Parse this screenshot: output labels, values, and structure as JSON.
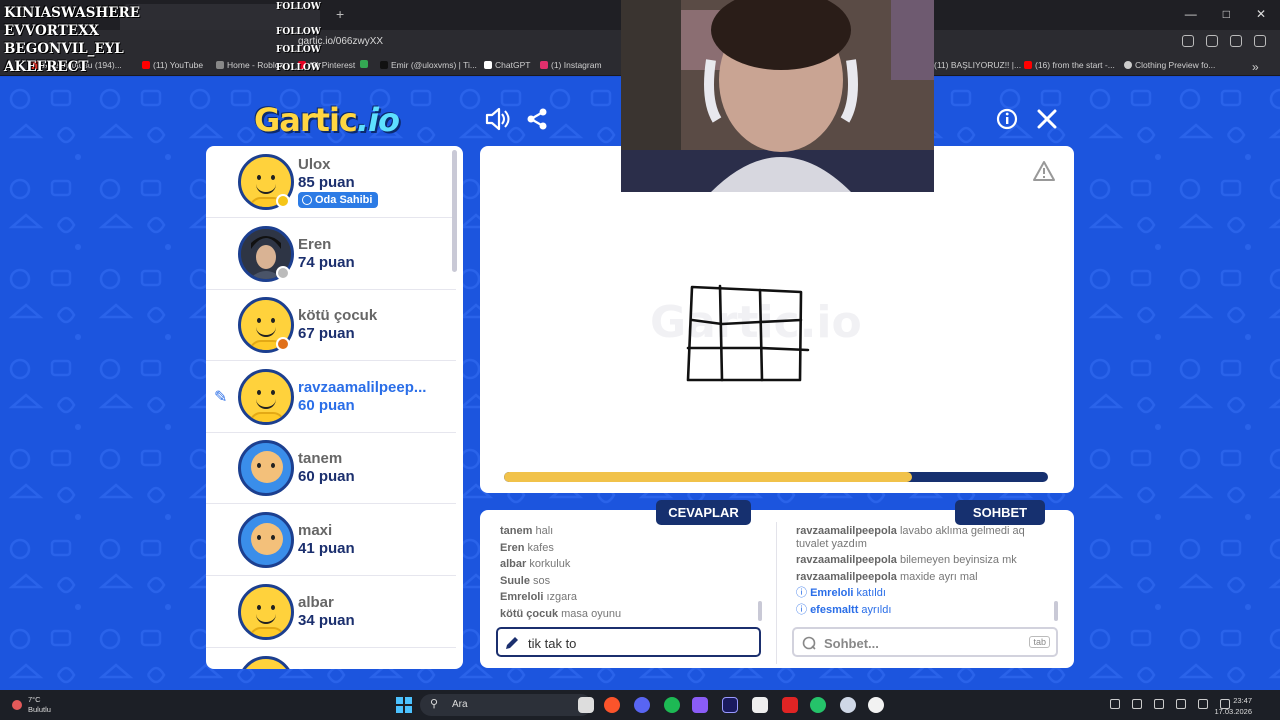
{
  "browser": {
    "url": "gartic.io/066zwyXX",
    "bookmarks": [
      {
        "label": "Gelen Kutusu (194)...",
        "color": "#d93025"
      },
      {
        "label": "(11) YouTube",
        "color": "#ff0000"
      },
      {
        "label": "Home - Roblox",
        "color": "#888888"
      },
      {
        "label": "(3) Pinterest",
        "color": "#e60023"
      },
      {
        "label": "",
        "color": "#34a853"
      },
      {
        "label": "Emir (@uloxvms) | Ti...",
        "color": "#111111"
      },
      {
        "label": "ChatGPT",
        "color": "#ffffff"
      },
      {
        "label": "(1) Instagram",
        "color": "#e1306c"
      },
      {
        "label": "(11) BAŞLIYORUZ!! |...",
        "color": "#ff0000"
      },
      {
        "label": "(16) from the start -...",
        "color": "#ff0000"
      },
      {
        "label": "Clothing Preview fo...",
        "color": "#cccccc"
      }
    ]
  },
  "stream_overlay": {
    "names": [
      "KINIASWASHERE",
      "EVVORTEXX",
      "BEGONVIL_EYL",
      "AKEFRECT"
    ],
    "follow_label": "FOLLOW"
  },
  "game": {
    "logo_main": "Gartic",
    "logo_io": ".io",
    "icons": [
      "sound-icon",
      "share-icon",
      "info-icon",
      "close-icon",
      "warning-icon"
    ],
    "timer_progress": 0.75,
    "players": [
      {
        "name": "Ulox",
        "score": "85 puan",
        "badge": "Oda Sahibi",
        "status_color": "#f5c518",
        "avatar": "default"
      },
      {
        "name": "Eren",
        "score": "74 puan",
        "status_color": "#bbbbbb",
        "avatar": "photo"
      },
      {
        "name": "kötü çocuk",
        "score": "67 puan",
        "status_color": "#e0701a",
        "avatar": "default"
      },
      {
        "name": "ravzaamalilpeep...",
        "score": "60 puan",
        "drawing": true,
        "avatar": "default"
      },
      {
        "name": "tanem",
        "score": "60 puan",
        "avatar": "blue"
      },
      {
        "name": "maxi",
        "score": "41 puan",
        "avatar": "blue"
      },
      {
        "name": "albar",
        "score": "34 puan",
        "avatar": "default"
      }
    ],
    "answers_tab": "CEVAPLAR",
    "chat_tab": "SOHBET",
    "answers": [
      {
        "who": "tanem",
        "text": "halı"
      },
      {
        "who": "Eren",
        "text": "kafes"
      },
      {
        "who": "albar",
        "text": "korkuluk"
      },
      {
        "who": "Suule",
        "text": "sos"
      },
      {
        "who": "Emreloli",
        "text": "ızgara"
      },
      {
        "who": "kötü çocuk",
        "text": "masa oyunu"
      }
    ],
    "chat": [
      {
        "who": "ravzaamalilpeepola",
        "text": "lavabo aklıma gelmedi aq tuvalet yazdım"
      },
      {
        "who": "ravzaamalilpeepola",
        "text": "bilemeyen beyinsiza mk"
      },
      {
        "who": "ravzaamalilpeepola",
        "text": "maxide ayrı mal"
      }
    ],
    "system_msgs": [
      {
        "who": "Emreloli",
        "text": "katıldı"
      },
      {
        "who": "efesmaltt",
        "text": "ayrıldı"
      }
    ],
    "answer_input_value": "tik tak to",
    "chat_placeholder": "Sohbet...",
    "tab_hint": "tab"
  },
  "taskbar": {
    "weather_temp": "7°C",
    "weather_desc": "Bulutlu",
    "search_label": "Ara",
    "time": "23:47",
    "date": "17.03.2026"
  }
}
